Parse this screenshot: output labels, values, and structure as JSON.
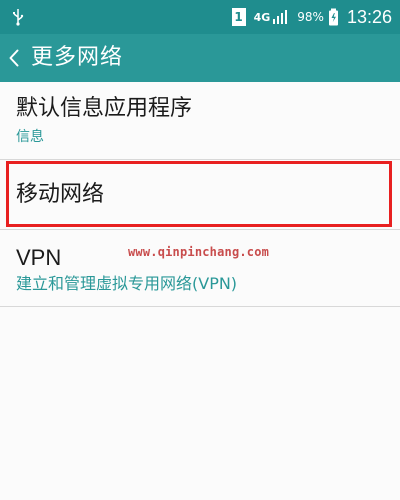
{
  "status_bar": {
    "sim_slot": "1",
    "network": "4G",
    "battery": "98%",
    "time": "13:26",
    "icons": {
      "usb": "usb-icon",
      "signal": "signal-icon",
      "battery": "battery-icon"
    },
    "background": "#1f8d8e"
  },
  "toolbar": {
    "title": "更多网络",
    "back_icon": "back-icon",
    "background": "#2a9898"
  },
  "settings": {
    "items": [
      {
        "title": "默认信息应用程序",
        "subtitle": "信息"
      },
      {
        "title": "移动网络",
        "highlight_color": "#e82020"
      },
      {
        "title": "VPN",
        "subtitle": "建立和管理虚拟专用网络(VPN)"
      }
    ]
  },
  "watermark": {
    "text": "www.qinpinchang.com",
    "color": "#c84c4c"
  }
}
